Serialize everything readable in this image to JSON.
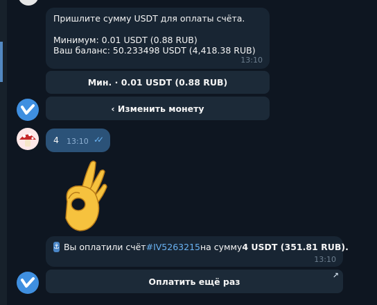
{
  "chat": {
    "bot_message": {
      "line1": "Пришлите сумму USDT для оплаты счёта.",
      "line2": "Минимум: 0.01 USDT (0.88 RUB)",
      "line3": "Ваш баланс: 50.233498 USDT (4,418.38 RUB)",
      "time": "13:10"
    },
    "keyboard": {
      "min_button": "Мин. · 0.01 USDT (0.88 RUB)",
      "change_coin_button": "‹ Изменить монету"
    },
    "user_message": {
      "text": "4",
      "time": "13:10",
      "status_ticks": "✓✓"
    },
    "sticker": {
      "name": "ok-hand-emoji"
    },
    "payment_message": {
      "icon": "anchor-icon",
      "prefix": "Вы оплатили счёт ",
      "invoice_tag": "#IV5263215",
      "middle": " на сумму ",
      "amount": "4 USDT (351.81 RUB).",
      "time": "13:10"
    },
    "pay_again_button": "Оплатить ещё раз",
    "pay_again_arrow": "↗"
  },
  "colors": {
    "background": "#0e1621",
    "incoming_bubble": "#182533",
    "outgoing_bubble": "#2b5278",
    "link": "#6ab3f3"
  }
}
